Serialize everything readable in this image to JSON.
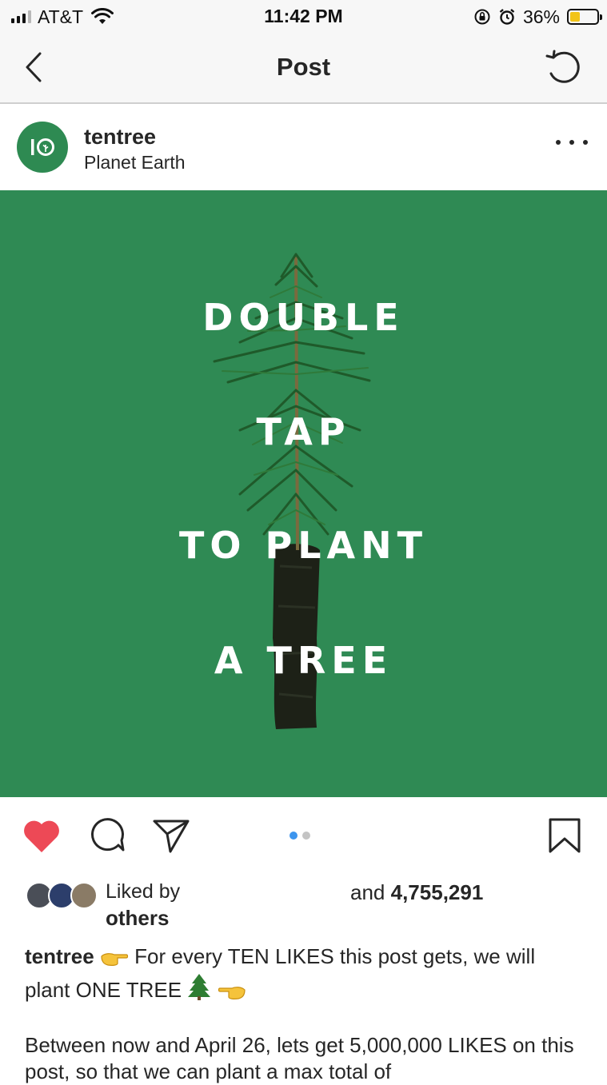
{
  "status_bar": {
    "carrier": "AT&T",
    "time": "11:42 PM",
    "battery_percent": "36%",
    "battery_level": 0.36,
    "battery_color": "#f2c418"
  },
  "nav": {
    "title": "Post",
    "back_icon": "chevron-left-icon",
    "refresh_icon": "refresh-icon"
  },
  "post": {
    "username": "tentree",
    "location": "Planet Earth",
    "avatar_mark": "10",
    "brand_color": "#2f8a54",
    "image_text": [
      "DOUBLE",
      "TAP",
      "TO PLANT",
      "A TREE"
    ],
    "carousel": {
      "count": 2,
      "active_index": 0
    }
  },
  "actions": {
    "like_icon": "heart-icon",
    "like_color": "#ed4956",
    "comment_icon": "comment-icon",
    "share_icon": "send-icon",
    "save_icon": "bookmark-icon"
  },
  "likes": {
    "liked_by_label": "Liked by",
    "and_label": "and",
    "count": "4,755,291",
    "others_label": "others"
  },
  "caption": {
    "username": "tentree",
    "text_part1": "For every TEN LIKES this post gets, we will plant ONE TREE",
    "paragraph2": "Between now and April 26, lets get 5,000,000 LIKES on this post, so that we can plant a max total of"
  }
}
